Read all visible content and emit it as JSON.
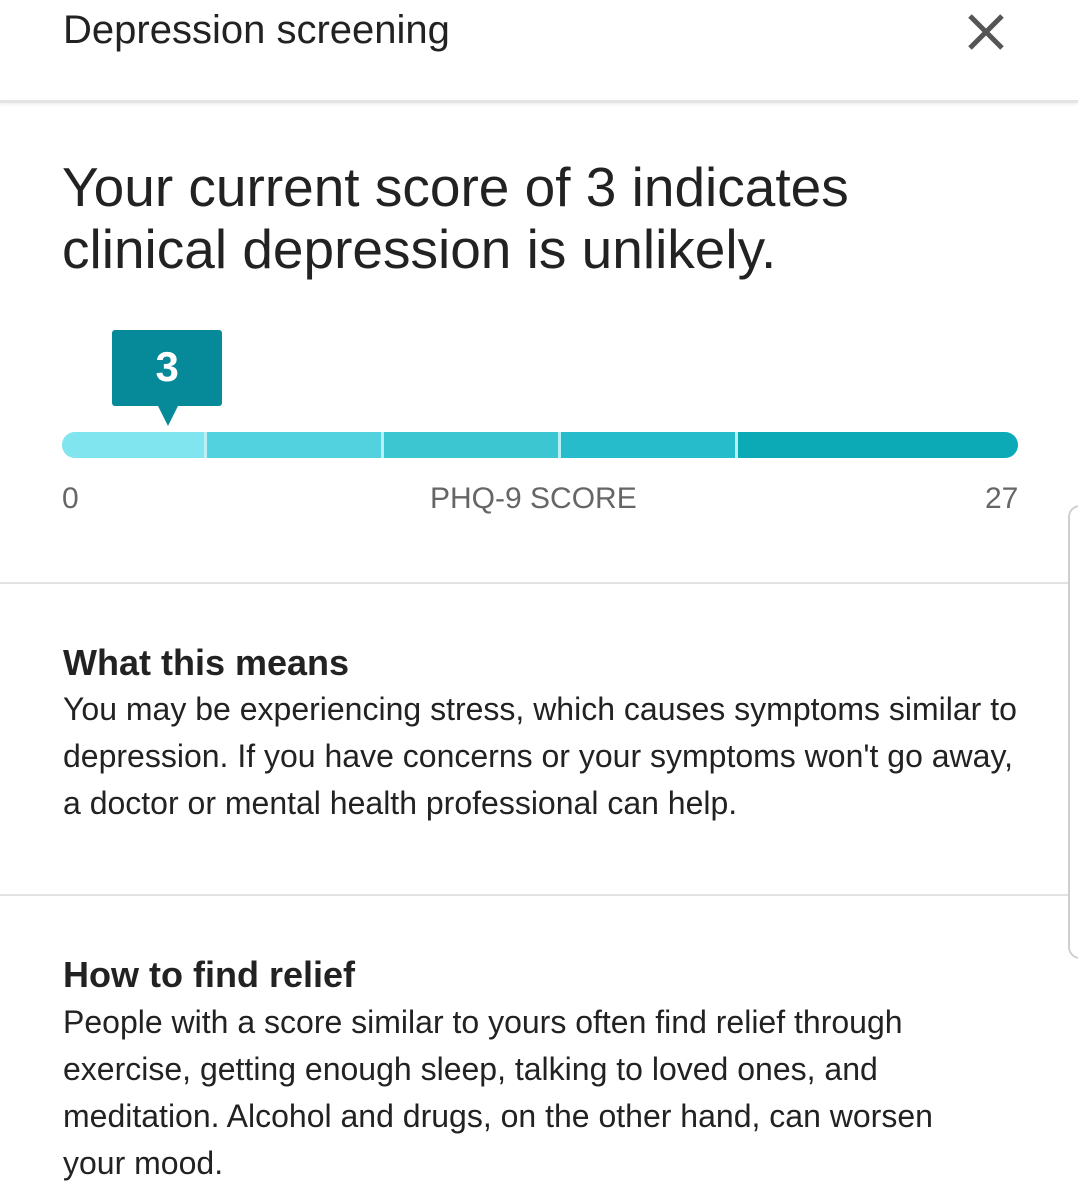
{
  "header": {
    "title": "Depression screening",
    "close_icon": "close-icon"
  },
  "result": {
    "headline": "Your current score of 3 indicates clinical depression is unlikely."
  },
  "score_scale": {
    "score": 3,
    "score_label": "3",
    "min": 0,
    "max": 27,
    "min_label": "0",
    "max_label": "27",
    "axis_label": "PHQ-9 SCORE",
    "segment_bounds": [
      0,
      4,
      9,
      14,
      19,
      27
    ],
    "segment_colors": [
      "#80e5ef",
      "#52d2de",
      "#3cc6d2",
      "#26bccb",
      "#0caab7"
    ],
    "marker_color": "#068a99"
  },
  "sections": [
    {
      "heading": "What this means",
      "body": "You may be experiencing stress, which causes symptoms similar to depression. If you have concerns or your symptoms won't go away, a doctor or mental health professional can help."
    },
    {
      "heading": "How to find relief",
      "body": "People with a score similar to yours often find relief through exercise, getting enough sleep, talking to loved ones, and meditation. Alcohol and drugs, on the other hand, can worsen your mood."
    }
  ]
}
